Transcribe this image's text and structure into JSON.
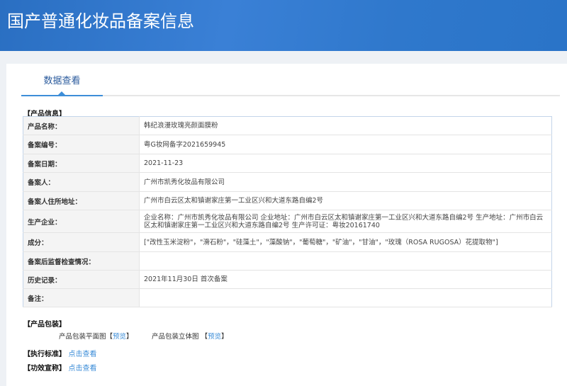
{
  "header": {
    "title": "国产普通化妆品备案信息"
  },
  "tab": {
    "label": "数据查看"
  },
  "product_info": {
    "section": "【产品信息】",
    "rows": [
      {
        "label": "产品名称：",
        "value": "韩纪浪漫玫瑰亮颜面膜粉"
      },
      {
        "label": "备案编号：",
        "value": "粤G妆网备字2021659945"
      },
      {
        "label": "备案日期：",
        "value": "2021-11-23"
      },
      {
        "label": "备案人：",
        "value": "广州市凯秀化妆品有限公司"
      },
      {
        "label": "备案人住所地址：",
        "value": "广州市白云区太和镇谢家庄第一工业区兴和大道东路自编2号"
      },
      {
        "label": "生产企业：",
        "value": "企业名称：广州市凯秀化妆品有限公司 企业地址：广州市白云区太和镇谢家庄第一工业区兴和大道东路自编2号 生产地址：广州市白云区太和镇谢家庄第一工业区兴和大道东路自编2号 生产许可证：粤妆20161740"
      },
      {
        "label": "成分：",
        "value": "[\"改性玉米淀粉\"，\"滑石粉\"，\"硅藻土\"，\"藻酸钠\"，\"葡萄糖\"，\"矿油\"，\"甘油\"，\"玫瑰（ROSA RUGOSA）花提取物\"]"
      },
      {
        "label": "备案后监督检查情况：",
        "value": ""
      },
      {
        "label": "历史记录：",
        "value": "2021年11月30日 首次备案"
      },
      {
        "label": "备注：",
        "value": ""
      }
    ]
  },
  "packaging": {
    "section": "【产品包装】",
    "flat_label": "产品包装平面图",
    "flat_link": "预览",
    "solid_label": "产品包装立体图",
    "solid_link": "预览",
    "bracket_open": "【",
    "bracket_close": "】"
  },
  "standard": {
    "section": "【执行标准】",
    "link": "点击查看"
  },
  "efficacy": {
    "section": "【功效宣称】",
    "link": "点击查看"
  }
}
